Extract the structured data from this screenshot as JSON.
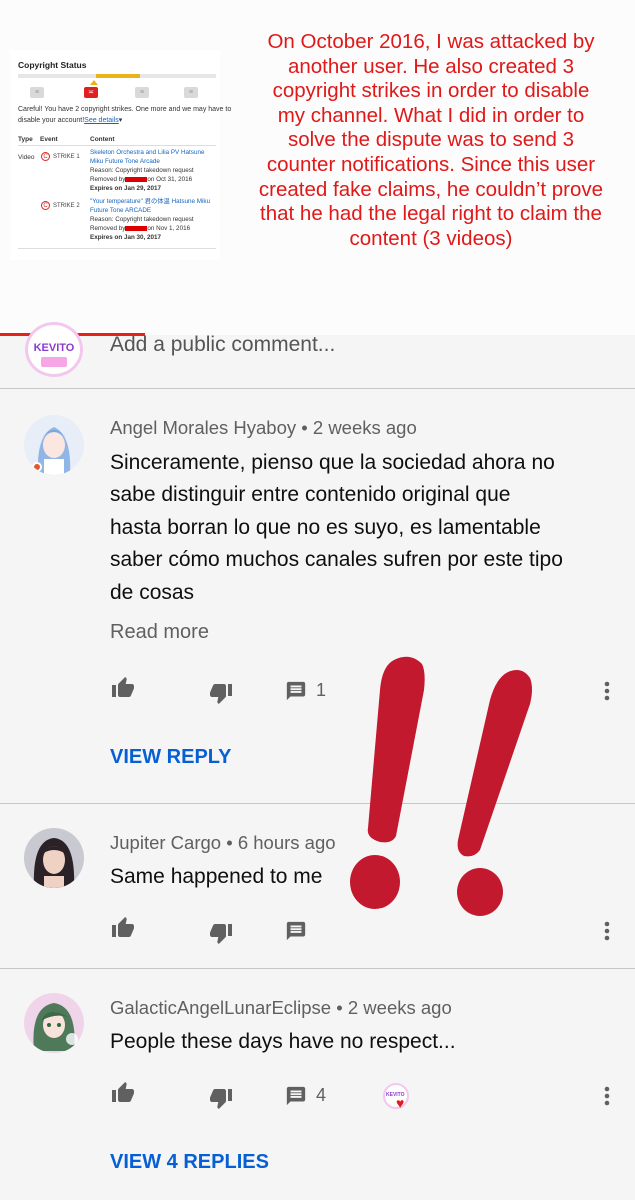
{
  "copyright_status": {
    "title": "Copyright Status",
    "warning_line1": "Careful! You have 2 copyright strikes. One more and we may have to",
    "warning_line2": "disable your account!",
    "see_details": "See details",
    "col_type": "Type",
    "col_event": "Event",
    "col_content": "Content",
    "type_value": "Video",
    "strikes": [
      {
        "label": "STRIKE 1",
        "title_line1": "Skeleton Orchestra and Lilia PV Hatsune",
        "title_line2": "Miku Future Tone Arcade",
        "reason": "Reason: Copyright takedown request",
        "removed_prefix": "Removed by",
        "removed_suffix": "on Oct 31, 2016",
        "expires": "Expires on Jan 29, 2017"
      },
      {
        "label": "STRIKE 2",
        "title_line1": "\"Your temperature\" 君の体温 Hatsune Miku",
        "title_line2": "Future Tone ARCADE",
        "reason": "Reason: Copyright takedown request",
        "removed_prefix": "Removed by",
        "removed_suffix": "on Nov 1, 2016",
        "expires": "Expires on Jan 30, 2017"
      }
    ]
  },
  "note_lines": [
    "On October 2016, I was attacked by",
    "another user. He also created 3",
    "copyright strikes in order to disable",
    "my channel. What I did in order to",
    "solve the dispute was to send 3",
    "counter notifications. Since this user",
    "created fake claims, he couldn’t prove",
    "that he had the legal right to claim the",
    "content (3 videos)"
  ],
  "comment_box": {
    "avatar_text": "KEVITO",
    "placeholder": "Add a public comment..."
  },
  "comments": [
    {
      "author": "Angel Morales Hyaboy",
      "time": "2 weeks ago",
      "text_lines": [
        "Sinceramente, pienso que la sociedad ahora no",
        "sabe distinguir entre contenido original que",
        "hasta borran lo que no es suyo, es lamentable",
        "saber cómo muchos canales sufren por este tipo",
        "de cosas"
      ],
      "read_more": "Read more",
      "reply_count": "1",
      "view_replies": "VIEW REPLY"
    },
    {
      "author": "Jupiter Cargo",
      "time": "6 hours ago",
      "text_lines": [
        "Same happened to me"
      ]
    },
    {
      "author": "GalacticAngelLunarEclipse",
      "time": "2 weeks ago",
      "text_lines": [
        "People these days have no respect..."
      ],
      "reply_count": "4",
      "hearted_by": "KEVITO",
      "view_replies": "VIEW 4 REPLIES"
    }
  ],
  "separator": " • ",
  "colors": {
    "note_red": "#e01818",
    "link_blue": "#065fd4",
    "exclamation_red": "#c3192f",
    "heart_red": "#e01b22"
  },
  "icons": {
    "like": "thumb-up-icon",
    "dislike": "thumb-down-icon",
    "reply": "comment-icon",
    "menu": "more-vert-icon",
    "heart": "heart-icon"
  }
}
